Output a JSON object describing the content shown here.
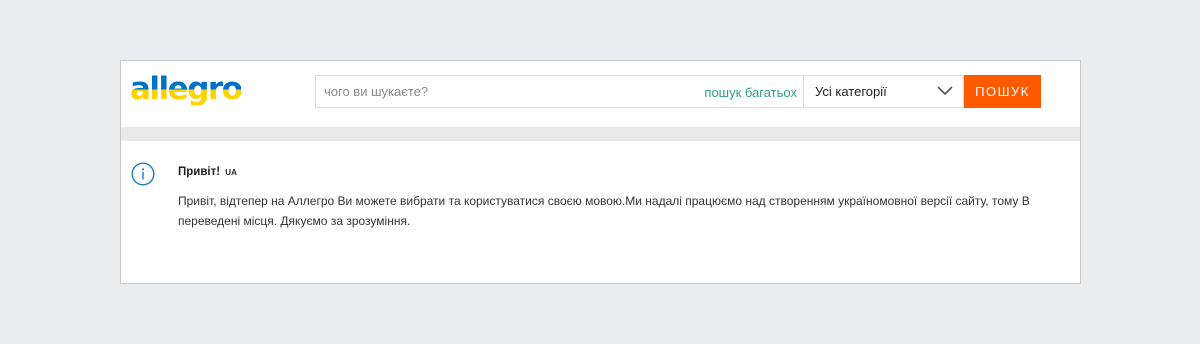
{
  "brand": {
    "logo_text": "allegro",
    "logo_colors": {
      "top": "#0072c6",
      "bottom": "#ffd200"
    }
  },
  "search": {
    "placeholder": "чого ви шукаєте?",
    "value": "",
    "multi_search_link": "пошук багатьох"
  },
  "category": {
    "selected": "Усі категорії"
  },
  "search_button": {
    "label": "ПОШУК"
  },
  "notice": {
    "title": "Привіт!",
    "badge": "UA",
    "line1": "Привіт, відтепер на Аллегро Ви можете вибрати та користуватися своєю мовою.Ми надалі працюємо над створенням україномовної версії сайту, тому В",
    "line2": "переведені місця. Дякуємо за зрозуміння."
  },
  "colors": {
    "accent": "#ff5a00",
    "link": "#2e9c89",
    "info_icon": "#1a7fc0",
    "background": "#eaedf0"
  },
  "icons": {
    "info": "info-icon",
    "dropdown": "chevron-down-icon"
  }
}
